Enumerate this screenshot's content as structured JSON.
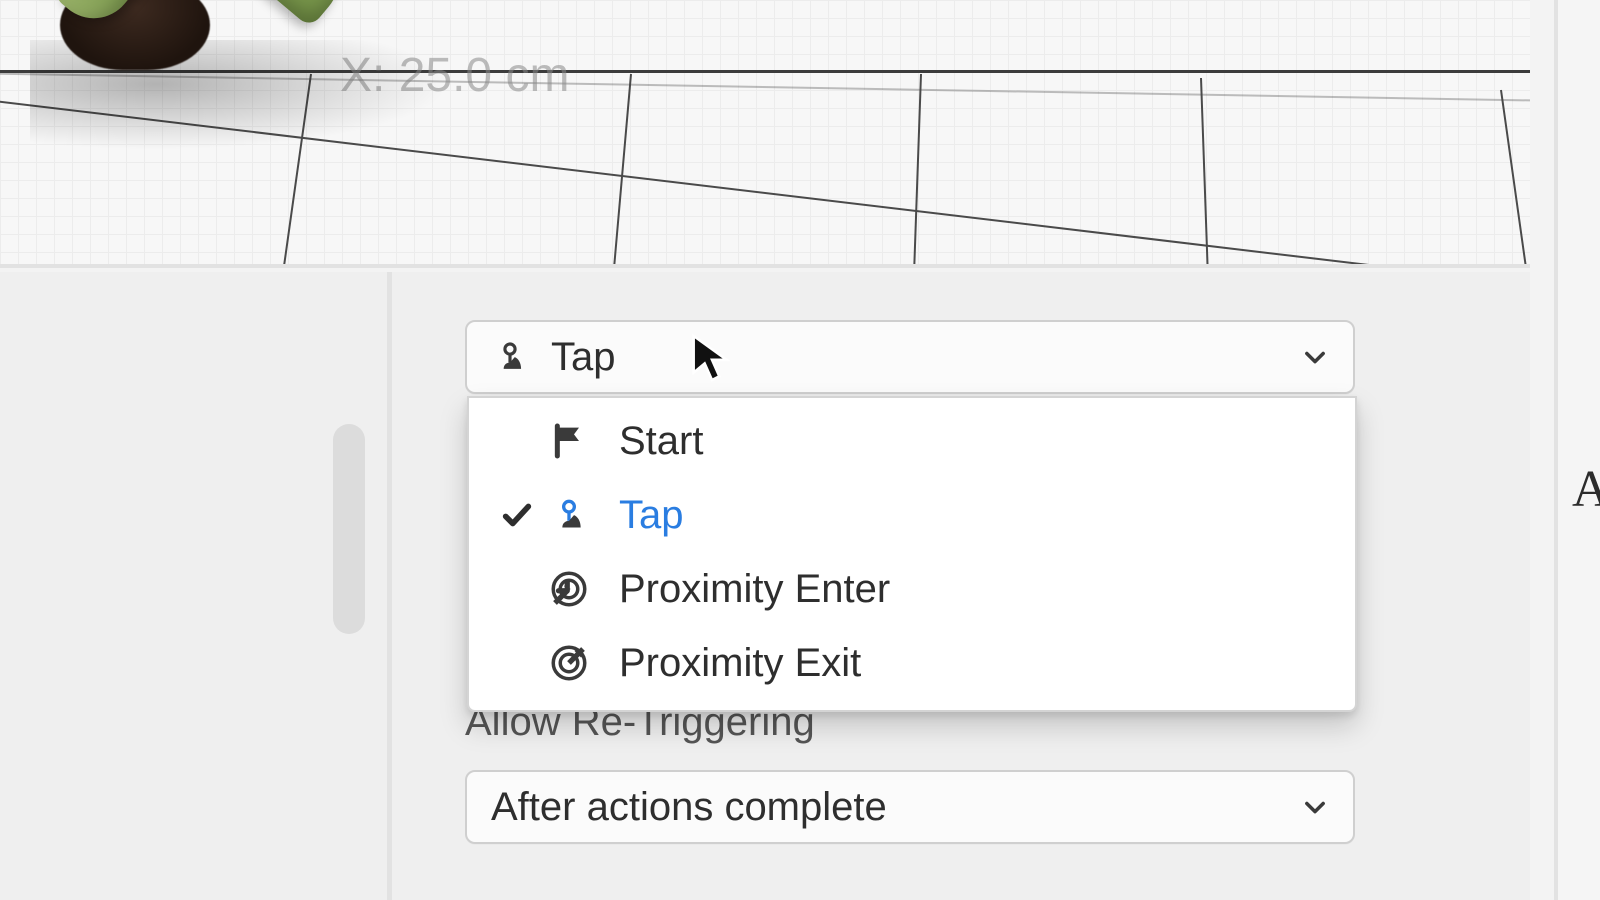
{
  "viewport": {
    "measurement_label": "X: 25.0 cm"
  },
  "trigger_select": {
    "selected_label": "Tap",
    "options": [
      {
        "id": "start",
        "label": "Start",
        "icon": "flag-icon",
        "selected": false
      },
      {
        "id": "tap",
        "label": "Tap",
        "icon": "tap-icon",
        "selected": true
      },
      {
        "id": "pentr",
        "label": "Proximity Enter",
        "icon": "proximity-enter-icon",
        "selected": false
      },
      {
        "id": "pexit",
        "label": "Proximity Exit",
        "icon": "proximity-exit-icon",
        "selected": false
      }
    ]
  },
  "retrigger": {
    "label": "Allow Re-Triggering",
    "selected_label": "After actions complete"
  },
  "right_panel": {
    "cut_letter": "A"
  },
  "colors": {
    "accent": "#2a7de1",
    "panel_bg": "#efefef",
    "border": "#cfcfcf"
  }
}
